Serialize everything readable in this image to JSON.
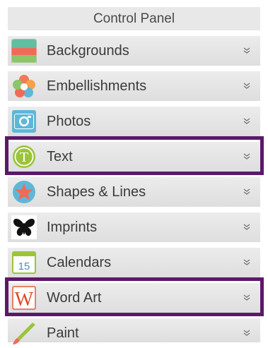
{
  "panel": {
    "title": "Control Panel",
    "items": [
      {
        "label": "Backgrounds",
        "icon": "backgrounds-icon"
      },
      {
        "label": "Embellishments",
        "icon": "flower-icon"
      },
      {
        "label": "Photos",
        "icon": "camera-icon"
      },
      {
        "label": "Text",
        "icon": "text-t-icon"
      },
      {
        "label": "Shapes & Lines",
        "icon": "star-icon"
      },
      {
        "label": "Imprints",
        "icon": "butterfly-icon"
      },
      {
        "label": "Calendars",
        "icon": "calendar-icon"
      },
      {
        "label": "Word Art",
        "icon": "word-art-w-icon"
      },
      {
        "label": "Paint",
        "icon": "paintbrush-icon"
      }
    ],
    "calendar_day": "15",
    "text_icon_letter": "T",
    "word_art_icon_letter": "W"
  },
  "colors": {
    "highlight": "#5c1869",
    "row_background": "#e4e4e4",
    "title_background": "#e8e8e8"
  }
}
